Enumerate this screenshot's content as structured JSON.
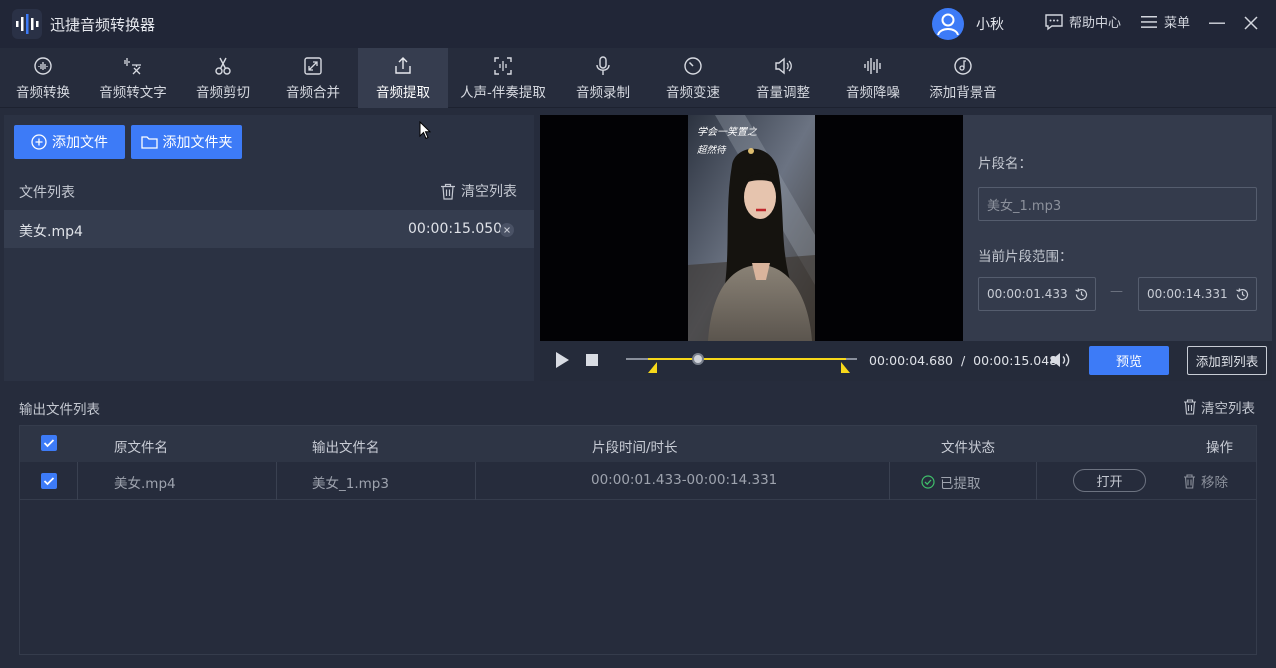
{
  "app": {
    "title": "迅捷音频转换器"
  },
  "user": {
    "name": "小秋"
  },
  "header": {
    "help": "帮助中心",
    "menu": "菜单"
  },
  "tools": [
    {
      "label": "音频转换",
      "icon": "audio-convert-icon"
    },
    {
      "label": "音频转文字",
      "icon": "audio-to-text-icon"
    },
    {
      "label": "音频剪切",
      "icon": "scissors-icon"
    },
    {
      "label": "音频合并",
      "icon": "merge-icon"
    },
    {
      "label": "音频提取",
      "icon": "upload-icon"
    },
    {
      "label": "人声-伴奏提取",
      "icon": "scan-icon"
    },
    {
      "label": "音频录制",
      "icon": "microphone-icon"
    },
    {
      "label": "音频变速",
      "icon": "speed-icon"
    },
    {
      "label": "音量调整",
      "icon": "volume-icon"
    },
    {
      "label": "音频降噪",
      "icon": "denoise-icon"
    },
    {
      "label": "添加背景音",
      "icon": "music-note-icon"
    }
  ],
  "active_tool": "音频提取",
  "left": {
    "add_file": "添加文件",
    "add_folder": "添加文件夹",
    "list_title": "文件列表",
    "clear": "清空列表",
    "files": [
      {
        "name": "美女.mp4",
        "duration": "00:00:15.050"
      }
    ]
  },
  "video": {
    "caption1": "学会一笑置之",
    "caption2": "超然待"
  },
  "props": {
    "segment_name_label": "片段名：",
    "segment_name_placeholder": "美女_1.mp3",
    "range_label": "当前片段范围：",
    "start": "00:00:01.433",
    "end": "00:00:14.331",
    "dash": "—"
  },
  "player": {
    "current": "00:00:04.680",
    "sep": "/",
    "total": "00:00:15.048",
    "preview": "预览",
    "add_to_list": "添加到列表",
    "progress": 0.31,
    "range_start": 0.095,
    "range_end": 0.952
  },
  "output": {
    "title": "输出文件列表",
    "clear": "清空列表",
    "headers": {
      "source": "原文件名",
      "output": "输出文件名",
      "segment": "片段时间/时长",
      "status": "文件状态",
      "ops": "操作"
    },
    "rows": [
      {
        "source": "美女.mp4",
        "output": "美女_1.mp3",
        "segment": "00:00:01.433-00:00:14.331",
        "status": "已提取",
        "open": "打开",
        "remove": "移除"
      }
    ]
  },
  "colors": {
    "accent": "#3d7bf7",
    "range": "#f7d81a",
    "success": "#3fbf6a"
  }
}
